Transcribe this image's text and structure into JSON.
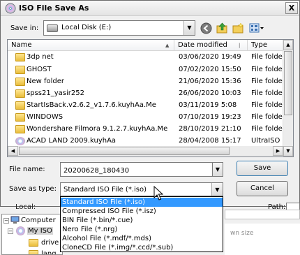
{
  "window": {
    "title": "ISO File Save As",
    "close_label": "X"
  },
  "save_in": {
    "label": "Save in:",
    "value": "Local Disk (E:)"
  },
  "file_list": {
    "columns": [
      {
        "label": "Name",
        "sort_indicator": "▲"
      },
      {
        "label": "Date modified",
        "sort_indicator": ""
      },
      {
        "label": "Type",
        "sort_indicator": ""
      }
    ],
    "rows": [
      {
        "name": "3dp net",
        "date": "03/06/2020 19:49",
        "type": "File folde",
        "icon": "folder-icon"
      },
      {
        "name": "GHOST",
        "date": "07/02/2020 15:50",
        "type": "File folde",
        "icon": "folder-icon"
      },
      {
        "name": "New folder",
        "date": "21/06/2020 15:36",
        "type": "File folde",
        "icon": "folder-icon"
      },
      {
        "name": "spss21_yasir252",
        "date": "26/06/2020 10:03",
        "type": "File folde",
        "icon": "folder-icon"
      },
      {
        "name": "StartIsBack.v2.6.2_v1.7.6.kuyhAa.Me",
        "date": "03/11/2019 5:08",
        "type": "File folde",
        "icon": "folder-icon"
      },
      {
        "name": "WINDOWS",
        "date": "07/10/2019 19:23",
        "type": "File folde",
        "icon": "folder-icon"
      },
      {
        "name": "Wondershare Filmora 9.1.2.7.kuyhAa.Me",
        "date": "28/10/2019 21:10",
        "type": "File folde",
        "icon": "folder-icon"
      },
      {
        "name": "ACAD LAND 2009.kuyhAa",
        "date": "28/04/2008 15:17",
        "type": "UltraISO",
        "icon": "iso-file-icon"
      }
    ]
  },
  "file_name": {
    "label": "File name:",
    "value": "20200628_180430"
  },
  "save_as_type": {
    "label": "Save as type:",
    "value": "Standard ISO File (*.iso)",
    "options": [
      "Standard ISO File (*.iso)",
      "Compressed ISO File (*.isz)",
      "BIN File (*.bin/*.cue)",
      "Nero File (*.nrg)",
      "Alcohol File (*.mdf/*.mds)",
      "CloneCD File (*.img/*.ccd/*.sub)"
    ],
    "selected_index": 0
  },
  "buttons": {
    "save": "Save",
    "cancel": "Cancel"
  },
  "background": {
    "local_label": "Local:",
    "path_label": "Path:",
    "tree": [
      {
        "label": "Computer",
        "glyph": "−",
        "icon": "computer-icon"
      },
      {
        "label": "My ISO",
        "glyph": "−",
        "icon": "cd-icon"
      },
      {
        "label": "drive",
        "glyph": "",
        "icon": "folder-icon"
      },
      {
        "label": "lang",
        "glyph": "",
        "icon": "folder-icon"
      }
    ],
    "right_fragment": "wn size"
  },
  "colors": {
    "selection": "#3399ff",
    "accent": "#3c7fb1"
  }
}
